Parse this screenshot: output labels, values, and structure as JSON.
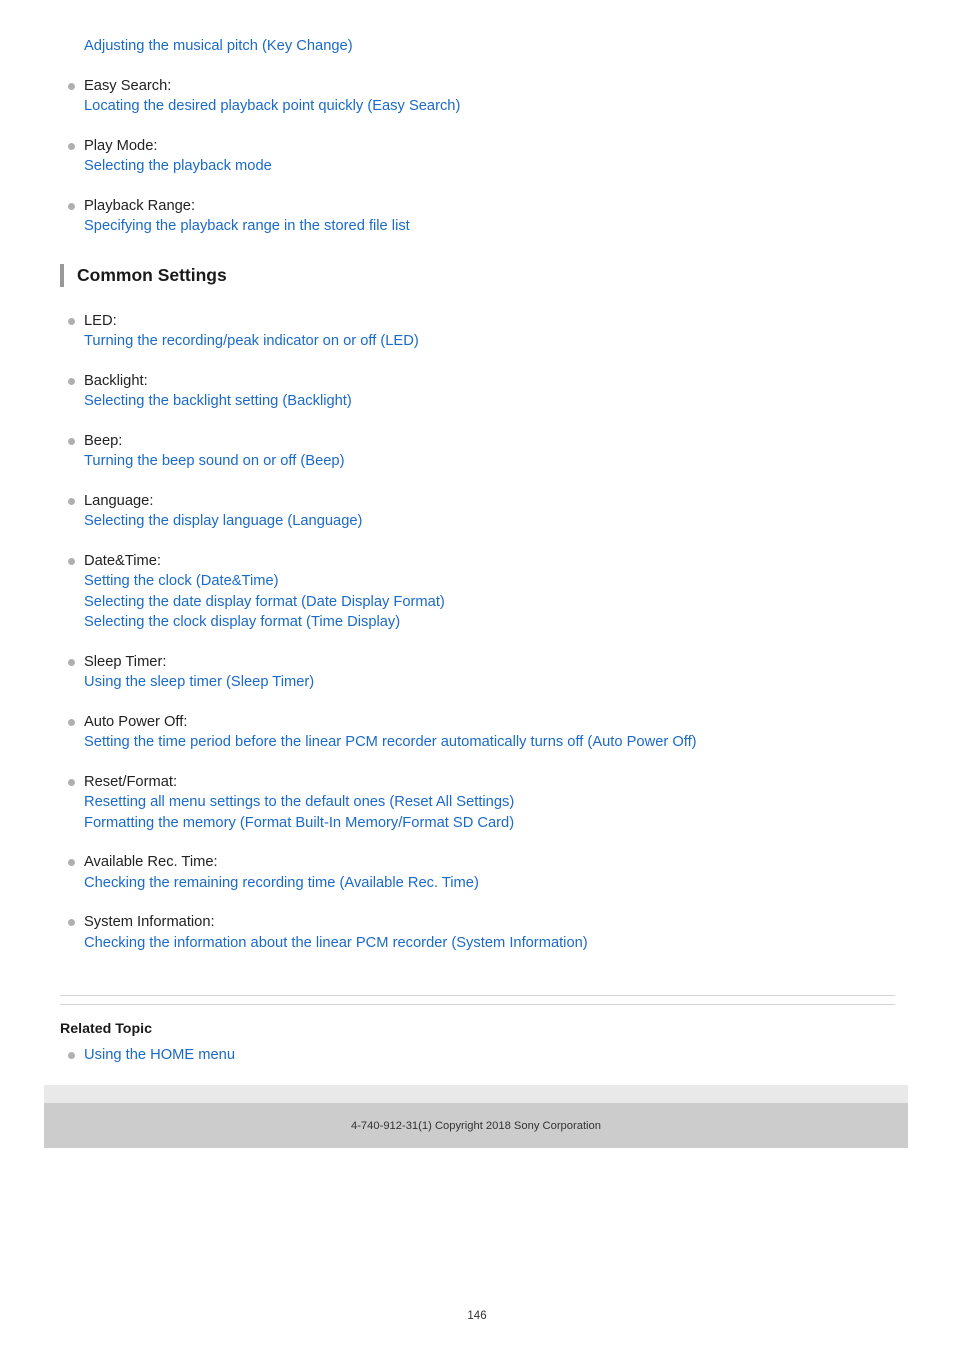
{
  "page": {
    "number": "146"
  },
  "top_continuation_link": "Adjusting the musical pitch (Key Change)",
  "playback_entries": [
    {
      "label": "Easy Search:",
      "links": [
        "Locating the desired playback point quickly (Easy Search)"
      ]
    },
    {
      "label": "Play Mode:",
      "links": [
        "Selecting the playback mode"
      ]
    },
    {
      "label": "Playback Range:",
      "links": [
        "Specifying the playback range in the stored file list"
      ]
    }
  ],
  "common_settings": {
    "heading": "Common Settings",
    "entries": [
      {
        "label": "LED:",
        "links": [
          "Turning the recording/peak indicator on or off (LED)"
        ]
      },
      {
        "label": "Backlight:",
        "links": [
          "Selecting the backlight setting (Backlight)"
        ]
      },
      {
        "label": "Beep:",
        "links": [
          "Turning the beep sound on or off (Beep)"
        ]
      },
      {
        "label": "Language:",
        "links": [
          "Selecting the display language (Language)"
        ]
      },
      {
        "label": "Date&Time:",
        "links": [
          "Setting the clock (Date&Time)",
          "Selecting the date display format (Date Display Format)",
          "Selecting the clock display format (Time Display)"
        ]
      },
      {
        "label": "Sleep Timer:",
        "links": [
          "Using the sleep timer (Sleep Timer)"
        ]
      },
      {
        "label": "Auto Power Off:",
        "links": [
          "Setting the time period before the linear PCM recorder automatically turns off (Auto Power Off)"
        ]
      },
      {
        "label": "Reset/Format:",
        "links": [
          "Resetting all menu settings to the default ones (Reset All Settings)",
          "Formatting the memory (Format Built-In Memory/Format SD Card)"
        ]
      },
      {
        "label": "Available Rec. Time:",
        "links": [
          "Checking the remaining recording time (Available Rec. Time)"
        ]
      },
      {
        "label": "System Information:",
        "links": [
          "Checking the information about the linear PCM recorder (System Information)"
        ]
      }
    ]
  },
  "related_topic": {
    "title": "Related Topic",
    "links": [
      "Using the HOME menu"
    ]
  },
  "footer": {
    "copyright": "4-740-912-31(1) Copyright 2018 Sony Corporation"
  },
  "colors": {
    "link": "#1b6ac8",
    "bullet": "#b0b0b0",
    "accent_bar": "#999999",
    "footer_light": "#e9e9e9",
    "footer_dark": "#cccccc",
    "rule": "#d3d3d3"
  }
}
